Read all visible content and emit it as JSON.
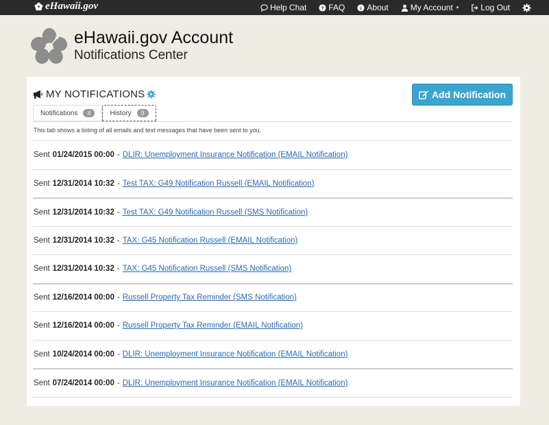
{
  "nav": {
    "brand": "eHawaii.gov",
    "links": [
      {
        "label": "Help Chat",
        "icon": "chat-icon"
      },
      {
        "label": "FAQ",
        "icon": "question-icon"
      },
      {
        "label": "About",
        "icon": "info-icon"
      },
      {
        "label": "My Account",
        "icon": "user-icon"
      },
      {
        "label": "Log Out",
        "icon": "logout-icon"
      }
    ]
  },
  "header": {
    "title": "eHawaii.gov Account",
    "subtitle": "Notifications Center"
  },
  "panel": {
    "title": "MY NOTIFICATIONS",
    "add_button": "Add Notification",
    "tabs": [
      {
        "label": "Notifications",
        "count": "4"
      },
      {
        "label": "History",
        "count": "9"
      }
    ],
    "description": "This tab shows a listing of all emails and text messages that have been sent to you."
  },
  "history": [
    {
      "prefix": "Sent",
      "date": "01/24/2015 00:00",
      "link": "DLIR: Unemployment Insurance Notification (EMAIL Notification)"
    },
    {
      "prefix": "Sent",
      "date": "12/31/2014 10:32",
      "link": "Test TAX: G49 Notification Russell (EMAIL Notification)"
    },
    {
      "prefix": "Sent",
      "date": "12/31/2014 10:32",
      "link": "Test TAX: G49 Notification Russell (SMS Notification)"
    },
    {
      "prefix": "Sent",
      "date": "12/31/2014 10:32",
      "link": "TAX: G45 Notification Russell (EMAIL Notification)"
    },
    {
      "prefix": "Sent",
      "date": "12/31/2014 10:32",
      "link": "TAX: G45 Notification Russell (SMS Notification)"
    },
    {
      "prefix": "Sent",
      "date": "12/16/2014 00:00",
      "link": "Russell Property Tax Reminder (SMS Notification)"
    },
    {
      "prefix": "Sent",
      "date": "12/16/2014 00:00",
      "link": "Russell Property Tax Reminder (EMAIL Notification)"
    },
    {
      "prefix": "Sent",
      "date": "10/24/2014 00:00",
      "link": "DLIR: Unemployment Insurance Notification (EMAIL Notification)"
    },
    {
      "prefix": "Sent",
      "date": "07/24/2014 00:00",
      "link": "DLIR: Unemployment Insurance Notification (EMAIL Notification)"
    }
  ],
  "colors": {
    "accent": "#3aa5cf",
    "link": "#2a6aad",
    "nav_bg": "#2a2a2a",
    "page_bg": "#efede3"
  }
}
